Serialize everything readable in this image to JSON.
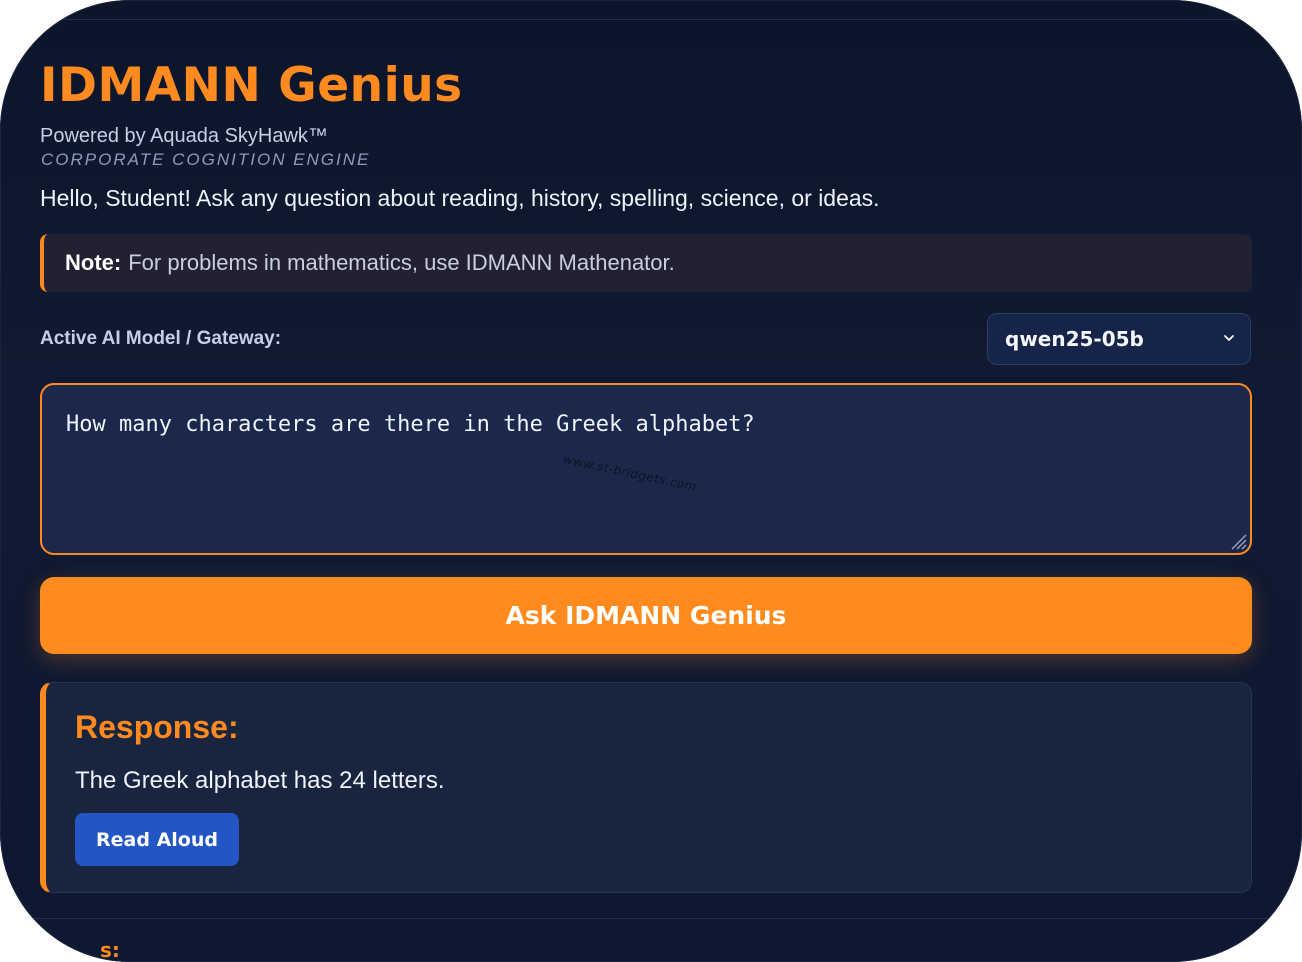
{
  "app": {
    "title": "IDMANN Genius",
    "powered_by": "Powered by Aquada SkyHawk™",
    "tagline": "CORPORATE COGNITION ENGINE",
    "greeting": "Hello, Student! Ask any question about reading, history, spelling, science, or ideas."
  },
  "note": {
    "label": "Note:",
    "text": "For problems in mathematics, use IDMANN Mathenator."
  },
  "model": {
    "label": "Active AI Model / Gateway:",
    "selected": "qwen25-05b"
  },
  "question": {
    "value": "How many characters are there in the Greek alphabet?"
  },
  "watermark": "www.st-bridgets.com",
  "ask_button": {
    "label": "Ask IDMANN Genius"
  },
  "response": {
    "heading": "Response:",
    "text": "The Greek alphabet has 24 letters.",
    "read_aloud_label": "Read Aloud"
  },
  "next_section": {
    "label_partial": "s:"
  },
  "icons": {
    "select": "chevron-down-icon",
    "textarea": "resize-grip-icon"
  },
  "colors": {
    "accent": "#ff8a1f",
    "background": "#0e1830",
    "panel": "#19243f",
    "primary_button": "#2356c4"
  }
}
